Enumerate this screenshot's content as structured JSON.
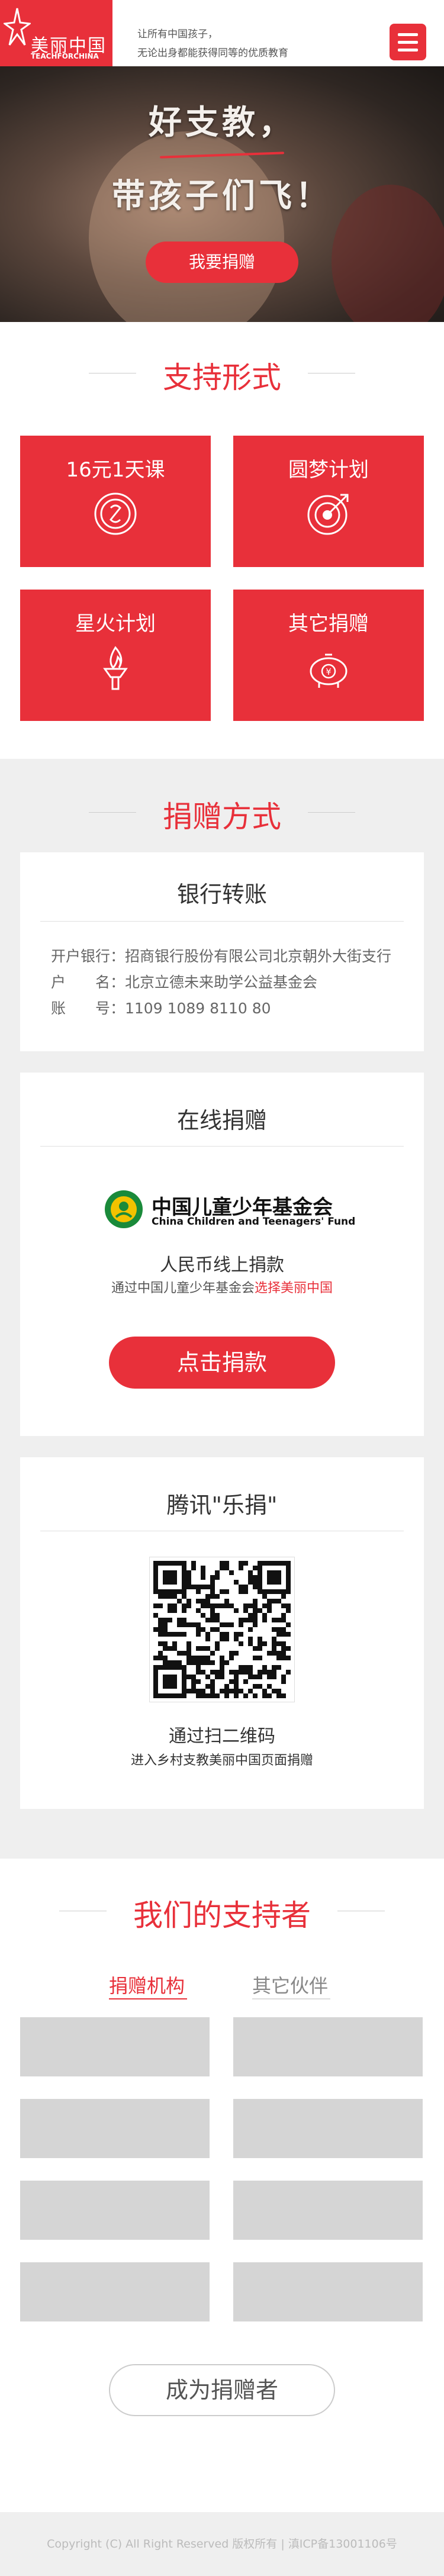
{
  "header": {
    "logo_cn": "美丽中国",
    "logo_en": "TEACHFORCHINA",
    "slogan_line1": "让所有中国孩子，",
    "slogan_line2": "无论出身都能获得同等的优质教育"
  },
  "hero": {
    "title_line1": "好支教，",
    "title_line2": "带孩子们飞！",
    "donate_label": "我要捐赠"
  },
  "support": {
    "title": "支持形式",
    "tiles": [
      {
        "label": "16元1天课",
        "icon": "coin-icon"
      },
      {
        "label": "圆梦计划",
        "icon": "target-icon"
      },
      {
        "label": "星火计划",
        "icon": "torch-icon"
      },
      {
        "label": "其它捐赠",
        "icon": "piggy-bank-icon"
      }
    ]
  },
  "methods": {
    "title": "捐赠方式",
    "bank": {
      "title": "银行转账",
      "rows": [
        "开户银行：招商银行股份有限公司北京朝外大街支行",
        "户　　名：北京立德未来助学公益基金会",
        "账　　号：1109 1089 8110 80"
      ]
    },
    "online": {
      "title": "在线捐赠",
      "fund_cn": "中国儿童少年基金会",
      "fund_en": "China Children and Teenagers' Fund",
      "desc": "人民币线上捐款",
      "sub_prefix": "通过中国儿童少年基金会",
      "sub_link": "选择美丽中国",
      "button": "点击捐款"
    },
    "tencent": {
      "title": "腾讯\"乐捐\"",
      "desc": "通过扫二维码",
      "sub": "进入乡村支教美丽中国页面捐赠"
    }
  },
  "supporters": {
    "title": "我们的支持者",
    "tabs": [
      "捐赠机构",
      "其它伙伴"
    ],
    "button": "成为捐赠者"
  },
  "footer": {
    "text": "Copyright (C) All Right Reserved 版权所有 | 滇ICP备13001106号"
  },
  "colors": {
    "accent": "#e8303a",
    "gray_bg": "#efefef",
    "placeholder": "#d5d5d5"
  }
}
